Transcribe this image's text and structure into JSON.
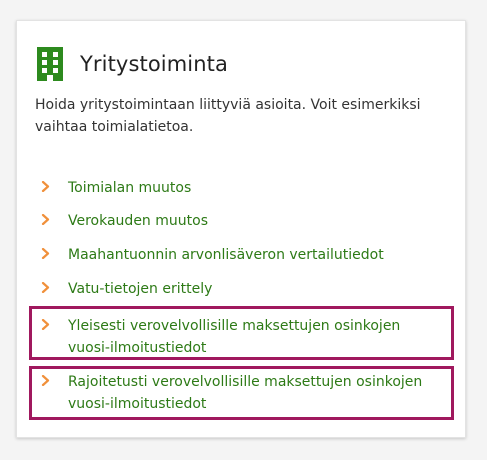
{
  "card": {
    "title": "Yritystoiminta",
    "description": "Hoida yritystoimintaan liittyviä asioita. Voit esimerkiksi vaihtaa toimialatietoa.",
    "links": [
      {
        "label": "Toimialan muutos"
      },
      {
        "label": "Verokauden muutos"
      },
      {
        "label": "Maahantuonnin arvonlisäveron vertailutiedot"
      },
      {
        "label": "Vatu-tietojen erittely"
      },
      {
        "label": "Yleisesti verovelvollisille maksettujen osinkojen vuosi-ilmoitustiedot"
      },
      {
        "label": "Rajoitetusti verovelvollisille maksettujen osinkojen vuosi-ilmoitustiedot"
      }
    ]
  },
  "colors": {
    "icon": "#2d8a1e",
    "chevron": "#f0903b",
    "link": "#2d7a16",
    "highlight": "#a0185e"
  },
  "icons": {
    "header": "building-icon",
    "link": "chevron-right-icon"
  }
}
